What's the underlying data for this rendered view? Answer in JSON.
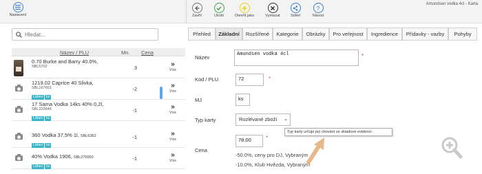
{
  "toolbar": {
    "settings_label": "Nastavení",
    "window_title": "Amundsen vodka 4cl - Karta",
    "buttons": [
      {
        "label": "Zavřít",
        "icon": "back-arrow-icon",
        "color": "#555555"
      },
      {
        "label": "Uložit",
        "icon": "check-icon",
        "color": "#3aa655"
      },
      {
        "label": "Otevřít jako",
        "icon": "plus-icon",
        "color": "#e8d21d"
      },
      {
        "label": "Vymazat",
        "icon": "close-icon",
        "color": "#333333"
      },
      {
        "label": "Sdílet",
        "icon": "share-icon",
        "color": "#3d7fc9"
      },
      {
        "label": "Návod",
        "icon": "help-icon",
        "color": "#3d7fc9"
      }
    ]
  },
  "search": {
    "placeholder": "Hledat..."
  },
  "list": {
    "headers": {
      "name_plu": "Název / PLU",
      "qty": "Mn.",
      "price": "Cena"
    },
    "more_label": "Více",
    "rows": [
      {
        "name": "0.70 Burke and Barry 40.0%,",
        "code": "SBL5702",
        "qty": "3",
        "tags": [],
        "thumb": "bottle"
      },
      {
        "name": "1219.02 Caprice 40 Slivka,",
        "code": "SBL167601",
        "qty": "-2",
        "tags": [
          "Láhev",
          "ks"
        ],
        "thumb": "camera"
      },
      {
        "name": "17 Sama Vodka 14ks 40% 0,2l,",
        "code": "SBL323646",
        "qty": "-1",
        "tags": [
          "Láhev",
          "ks"
        ],
        "thumb": "camera"
      },
      {
        "name": "360 Vodka 37,5% 1l,",
        "code": "SBL6362",
        "qty": "-1",
        "tags": [
          "Láhev",
          "ks"
        ],
        "thumb": "camera"
      },
      {
        "name": "40% Vodka 1906,",
        "code": "SBL276550",
        "qty": "-1",
        "tags": [
          "Láhev",
          "ks"
        ],
        "thumb": "camera"
      }
    ]
  },
  "tabs": [
    "Přehled",
    "Základní",
    "Rozšířené",
    "Kategorie",
    "Obrázky",
    "Pro veřejnost",
    "Ingredience",
    "Přídavky - vazby",
    "Pohyby"
  ],
  "active_tab": "Základní",
  "form": {
    "name_label": "Název",
    "name_value": "Amundsen vodka 4cl",
    "plu_label": "Kód / PLU",
    "plu_value": "72",
    "mj_label": "MJ",
    "mj_value": "ks",
    "type_label": "Typ karty",
    "type_value": "Rozlévané zboží",
    "type_tooltip": "Typ karty určuje její chování ve skladové evidenci.",
    "price_label": "Cena",
    "price_value": "78.00",
    "required_mark": "*",
    "discounts": [
      "-50.0%, ceny pro DJ, Vybraným",
      "-10.0%, Klub Hvězda, Vybraným"
    ]
  },
  "colors": {
    "accent": "#3d7fc9",
    "tag": "#3ab4c9",
    "required": "#d9534f"
  }
}
